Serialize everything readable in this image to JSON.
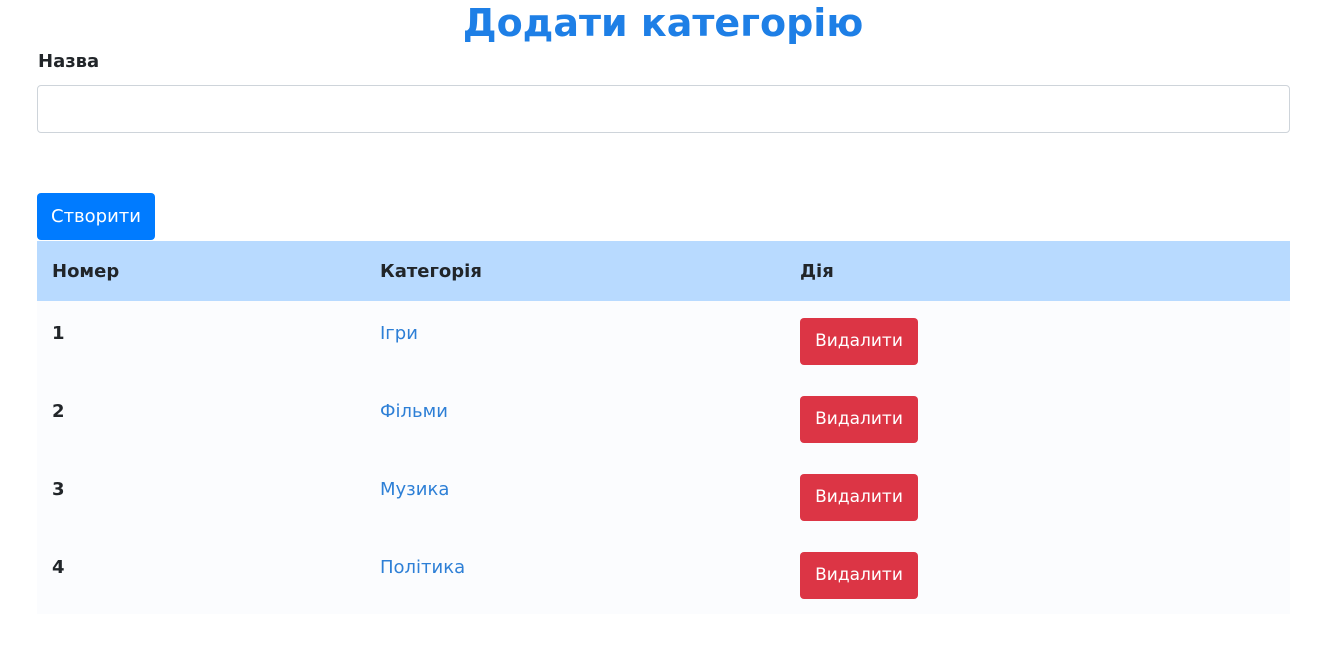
{
  "page": {
    "title": "Додати категорію"
  },
  "form": {
    "name_label": "Назва",
    "name_value": "",
    "name_placeholder": "",
    "create_label": "Створити"
  },
  "table": {
    "headers": [
      "Номер",
      "Категорія",
      "Дія"
    ],
    "rows": [
      {
        "number": "1",
        "category": "Ігри",
        "action": "Видалити"
      },
      {
        "number": "2",
        "category": "Фільми",
        "action": "Видалити"
      },
      {
        "number": "3",
        "category": "Музика",
        "action": "Видалити"
      },
      {
        "number": "4",
        "category": "Політика",
        "action": "Видалити"
      }
    ]
  },
  "colors": {
    "title": "#1e7fe6",
    "primary": "#007bff",
    "danger": "#dc3545",
    "table_header": "#b8daff",
    "link": "#2d7fd6"
  }
}
